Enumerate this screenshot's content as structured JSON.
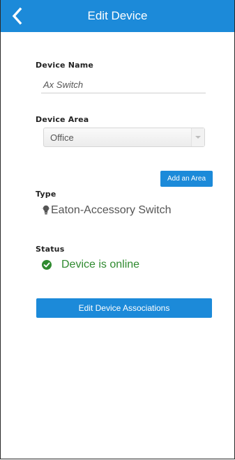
{
  "header": {
    "title": "Edit Device",
    "back_icon": "chevron-left-icon"
  },
  "device_name": {
    "label": "Device Name",
    "value": "Ax Switch"
  },
  "device_area": {
    "label": "Device Area",
    "selected": "Office",
    "add_button": "Add an Area"
  },
  "type": {
    "label": "Type",
    "icon": "lightbulb-icon",
    "value": "Eaton-Accessory Switch"
  },
  "status": {
    "label": "Status",
    "icon": "check-circle-icon",
    "value": "Device is online",
    "color": "#2f8a2f"
  },
  "actions": {
    "edit_associations": "Edit Device Associations"
  },
  "theme": {
    "accent": "#1c8ad9"
  }
}
